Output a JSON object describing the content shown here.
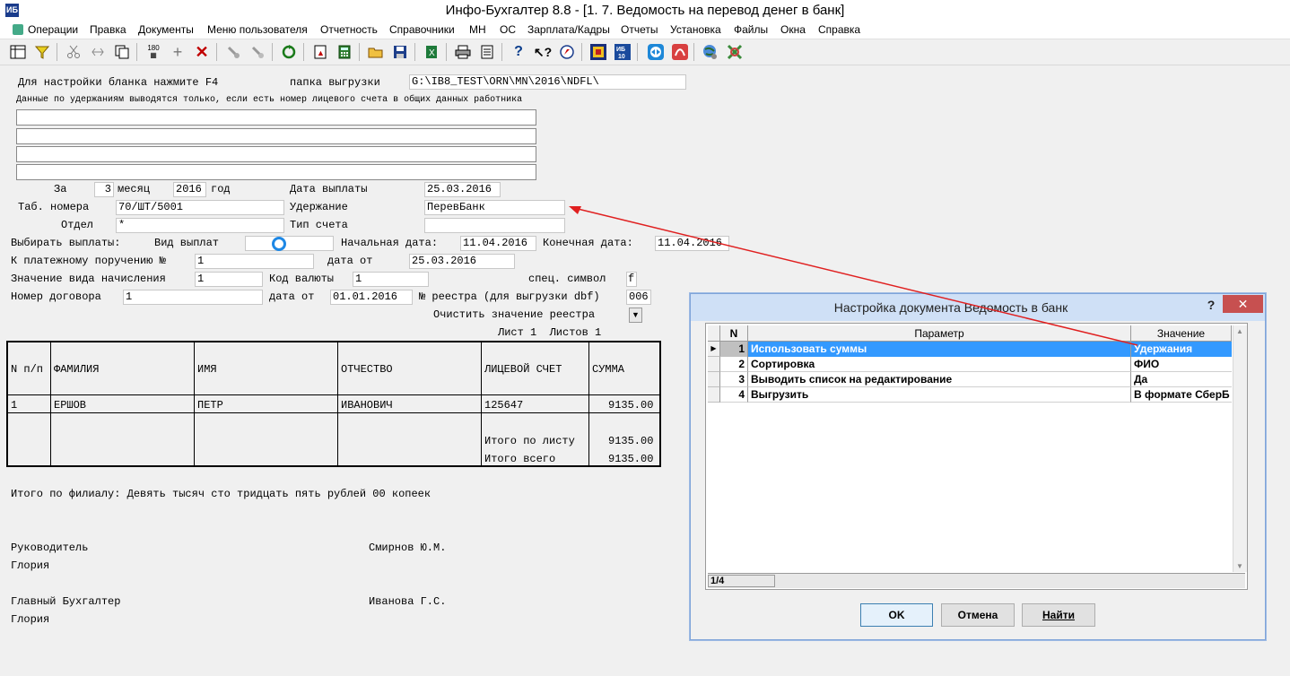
{
  "window": {
    "title": "Инфо-Бухгалтер 8.8 - [1. 7. Ведомость на перевод денег в банк]"
  },
  "menu": [
    "Операции",
    "Правка",
    "Документы",
    "Меню пользователя",
    "Отчетность",
    "Справочники",
    "МН",
    "ОС",
    "Зарплата/Кадры",
    "Отчеты",
    "Установка",
    "Файлы",
    "Окна",
    "Справка"
  ],
  "toolbar_icons": [
    "table-icon",
    "filter-icon",
    "cut-icon",
    "split-icon",
    "copy-icon",
    "sort-icon",
    "add-icon",
    "delete-icon",
    "tool1-icon",
    "tool2-icon",
    "refresh-icon",
    "pdf-icon",
    "calculator-icon",
    "open-folder-icon",
    "save-icon",
    "export-excel-icon",
    "print-icon",
    "preview-icon",
    "help-icon",
    "context-help-icon",
    "compass-icon",
    "ib-icon",
    "ib10-icon",
    "teamviewer-icon",
    "pdf-red-icon",
    "globe-icon",
    "network-icon"
  ],
  "form": {
    "f4_hint": "Для настройки бланка нажмите F4",
    "export_folder_label": "папка выгрузки",
    "export_folder_value": "G:\\IB8_TEST\\ORN\\MN\\2016\\NDFL\\",
    "note": "Данные по удержаниям выводятся только, если есть номер лицевого счета в общих данных работника",
    "for_label": "За",
    "month_value": "3",
    "month_label": "месяц",
    "year_value": "2016",
    "year_label": "год",
    "pay_date_label": "Дата выплаты",
    "pay_date_value": "25.03.2016",
    "tab_label": "Таб. номера",
    "tab_value": "70/ШТ/5001",
    "deduction_label": "Удержание",
    "deduction_value": "ПеревБанк",
    "dept_label": "Отдел",
    "dept_value": "*",
    "account_type_label": "Тип счета",
    "choose_label": "Выбирать выплаты:",
    "pay_type_label": "Вид выплат",
    "start_label": "Начальная дата:",
    "start_value": "11.04.2016",
    "end_label": "Конечная дата:",
    "end_value": "11.04.2016",
    "order_label": "К платежному поручению №",
    "order_value": "1",
    "date_from_label": "дата от",
    "order_date_value": "25.03.2016",
    "accrual_label": "Значение вида начисления",
    "accrual_value": "1",
    "currency_label": "Код валюты",
    "currency_value": "1",
    "special_label": "спец. символ",
    "special_value": "f",
    "contract_label": "Номер договора",
    "contract_value": "1",
    "contract_date_label": "дата от",
    "contract_date_value": "01.01.2016",
    "registry_label": "№ реестра (для выгрузки dbf)",
    "registry_value": "006",
    "clear_registry_label": "Очистить значение реестра",
    "sheet_label": "Лист 1  Листов 1"
  },
  "table": {
    "headers": [
      "N п/п",
      "ФАМИЛИЯ",
      "ИМЯ",
      "ОТЧЕСТВО",
      "ЛИЦЕВОЙ СЧЕТ",
      "СУММА"
    ],
    "row": [
      "1",
      "ЕРШОВ",
      "ПЕТР",
      "ИВАНОВИЧ",
      "125647",
      "9135.00"
    ],
    "total_sheet_label": "Итого по листу",
    "total_sheet_value": "9135.00",
    "total_all_label": "Итого всего",
    "total_all_value": "9135.00"
  },
  "footer": {
    "branch_total": "Итого по филиалу: Девять тысяч сто тридцать пять рублей 00 копеек",
    "head_label": "Руководитель",
    "head_name": "Смирнов Ю.М.",
    "head_org": "Глория",
    "chief_label": "Главный Бухгалтер",
    "chief_name": "Иванова Г.С.",
    "chief_org": "Глория"
  },
  "dialog": {
    "title": "Настройка документа Ведомость в банк",
    "help": "?",
    "close": "✕",
    "columns": [
      "N",
      "Параметр",
      "Значение"
    ],
    "rows": [
      {
        "n": "1",
        "param": "Использовать суммы",
        "value": "Удержания"
      },
      {
        "n": "2",
        "param": "Сортировка",
        "value": "ФИО"
      },
      {
        "n": "3",
        "param": "Выводить список на редактирование",
        "value": "Да"
      },
      {
        "n": "4",
        "param": "Выгрузить",
        "value": "В формате СберБ"
      }
    ],
    "status": "1/4",
    "ok": "OK",
    "cancel": "Отмена",
    "find": "Найти"
  },
  "colors": {
    "selection": "#3399ff",
    "arrow": "#e02020",
    "close": "#c75050"
  }
}
